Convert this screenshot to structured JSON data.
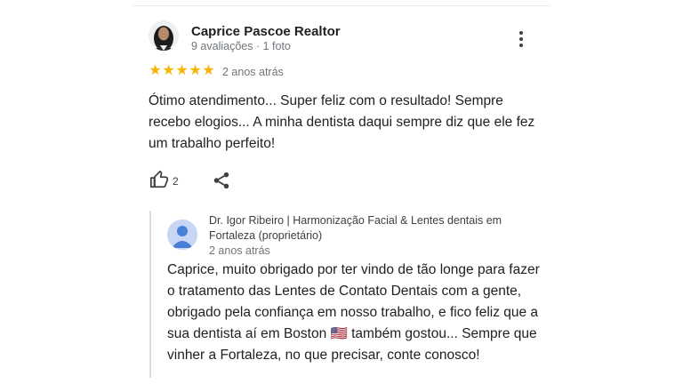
{
  "review": {
    "author_name": "Caprice Pascoe Realtor",
    "author_meta": "9 avaliações · 1 foto",
    "rating": 5,
    "stars": [
      "★",
      "★",
      "★",
      "★",
      "★"
    ],
    "time": "2 anos atrás",
    "text": "Ótimo atendimento... Super feliz com o resultado! Sempre recebo elogios... A minha dentista daqui sempre diz que ele fez um trabalho perfeito!",
    "like_count": "2",
    "star_color": "#f6b400"
  },
  "reply": {
    "author": "Dr. Igor Ribeiro | Harmonização Facial & Lentes dentais em Fortaleza (proprietário)",
    "time": "2 anos atrás",
    "text": "Caprice, muito obrigado por ter vindo de tão longe para fazer o tratamento das Lentes de Contato Dentais com a gente, obrigado pela confiança em nosso trabalho, e fico feliz que a sua dentista aí em Boston 🇺🇸 também gostou... Sempre que vinher a Fortaleza, no que precisar, conte conosco!"
  },
  "icons": {
    "more": "more-vertical-icon",
    "like": "thumbs-up-icon",
    "share": "share-icon",
    "owner_avatar": "person-icon"
  }
}
